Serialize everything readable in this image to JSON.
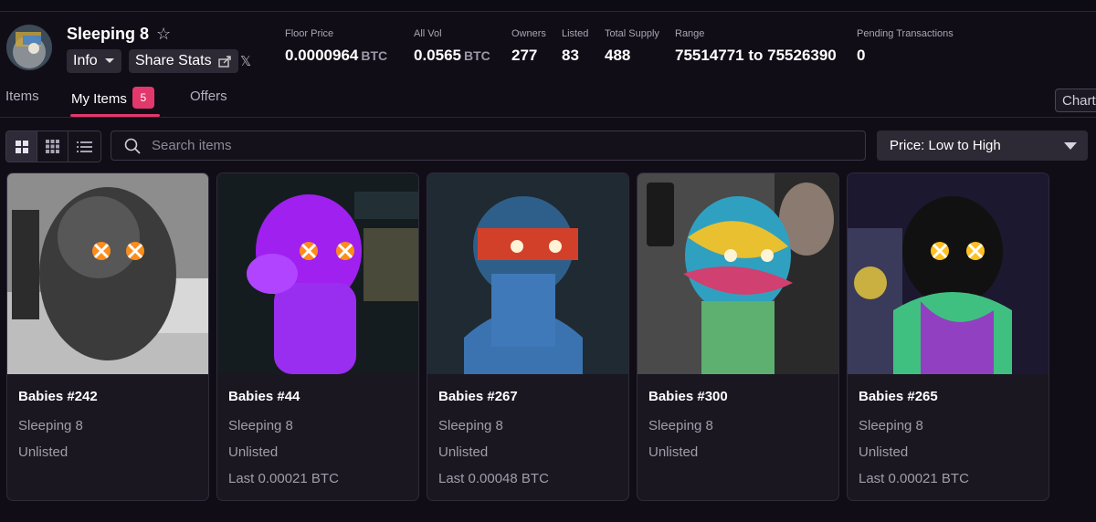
{
  "collection": {
    "name": "Sleeping 8",
    "info_label": "Info",
    "share_label": "Share Stats"
  },
  "stats": [
    {
      "label": "Floor Price",
      "value": "0.0000964",
      "unit": "BTC"
    },
    {
      "label": "All Vol",
      "value": "0.0565",
      "unit": "BTC"
    },
    {
      "label": "Owners",
      "value": "277",
      "unit": ""
    },
    {
      "label": "Listed",
      "value": "83",
      "unit": ""
    },
    {
      "label": "Total Supply",
      "value": "488",
      "unit": ""
    },
    {
      "label": "Range",
      "value": "75514771 to 75526390",
      "unit": ""
    },
    {
      "label": "Pending Transactions",
      "value": "0",
      "unit": ""
    }
  ],
  "tabs": [
    {
      "label": "Items"
    },
    {
      "label": "My Items",
      "badge": "5"
    },
    {
      "label": "Offers"
    }
  ],
  "chart_label": "Chart",
  "search": {
    "placeholder": "Search items"
  },
  "sort": {
    "selected": "Price: Low to High"
  },
  "colors": {
    "accent": "#e2386c",
    "background": "#100d17",
    "card": "#1a1721"
  },
  "items": [
    {
      "name": "Babies #242",
      "collection": "Sleeping 8",
      "status": "Unlisted",
      "last": ""
    },
    {
      "name": "Babies #44",
      "collection": "Sleeping 8",
      "status": "Unlisted",
      "last": "Last 0.00021 BTC"
    },
    {
      "name": "Babies #267",
      "collection": "Sleeping 8",
      "status": "Unlisted",
      "last": "Last 0.00048 BTC"
    },
    {
      "name": "Babies #300",
      "collection": "Sleeping 8",
      "status": "Unlisted",
      "last": ""
    },
    {
      "name": "Babies #265",
      "collection": "Sleeping 8",
      "status": "Unlisted",
      "last": "Last 0.00021 BTC"
    }
  ]
}
